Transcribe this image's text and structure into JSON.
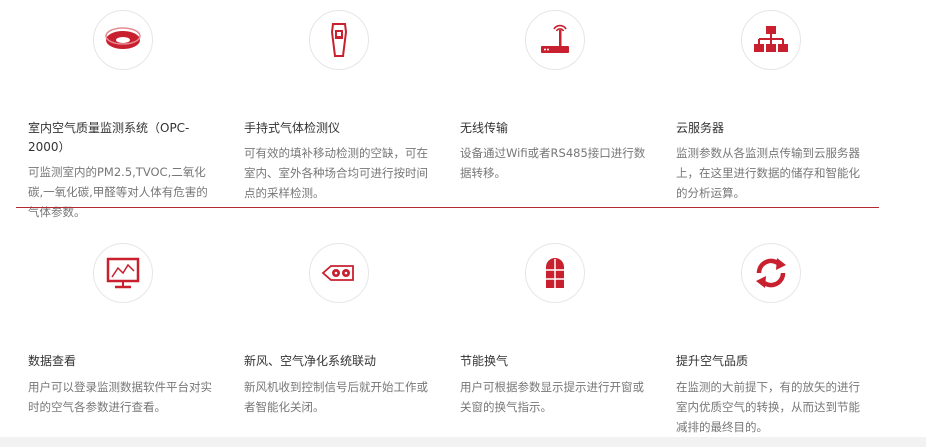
{
  "accent_color": "#c8202f",
  "features": [
    {
      "icon": "ceiling-sensor-icon",
      "title": "室内空气质量监测系统（OPC-2000）",
      "desc": "可监测室内的PM2.5,TVOC,二氧化碳,一氧化碳,甲醛等对人体有危害的气体参数。"
    },
    {
      "icon": "handheld-detector-icon",
      "title": "手持式气体检测仪",
      "desc": "可有效的填补移动检测的空缺，可在室内、室外各种场合均可进行按时间点的采样检测。"
    },
    {
      "icon": "wireless-router-icon",
      "title": "无线传输",
      "desc": "设备通过Wifi或者RS485接口进行数据转移。"
    },
    {
      "icon": "server-network-icon",
      "title": "云服务器",
      "desc": "监测参数从各监测点传输到云服务器上，在这里进行数据的储存和智能化的分析运算。"
    },
    {
      "icon": "monitor-chart-icon",
      "title": "数据查看",
      "desc": "用户可以登录监测数据软件平台对实时的空气各参数进行查看。"
    },
    {
      "icon": "fresh-air-unit-icon",
      "title": "新风、空气净化系统联动",
      "desc": "新风机收到控制信号后就开始工作或者智能化关闭。"
    },
    {
      "icon": "window-icon",
      "title": "节能换气",
      "desc": "用户可根据参数显示提示进行开窗或关窗的换气指示。"
    },
    {
      "icon": "refresh-cycle-icon",
      "title": "提升空气品质",
      "desc": "在监测的大前提下，有的放矢的进行室内优质空气的转换，从而达到节能减排的最终目的。"
    }
  ]
}
